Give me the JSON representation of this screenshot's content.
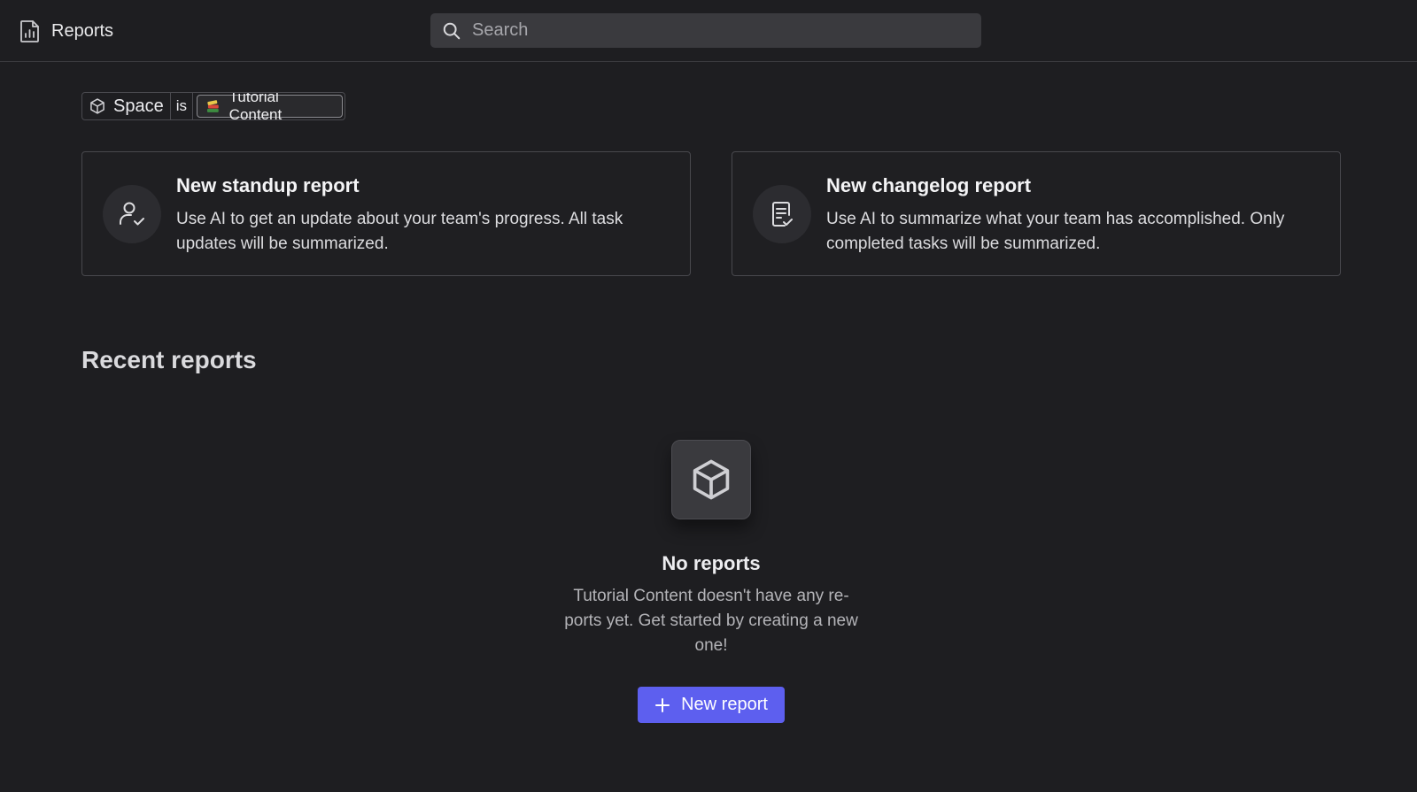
{
  "header": {
    "title": "Reports",
    "title_icon": "report-chart-icon",
    "search_placeholder": "Search"
  },
  "filter": {
    "field_icon": "cube-icon",
    "field": "Space",
    "operator": "is",
    "value_icon": "books-emoji",
    "value": "Tutorial Content"
  },
  "cards": [
    {
      "icon": "user-check-icon",
      "title": "New standup report",
      "description": "Use AI to get an update about your team's progress. All task updates will be summarized."
    },
    {
      "icon": "document-check-icon",
      "title": "New changelog report",
      "description": "Use AI to summarize what your team has accomplished. Only completed tasks will be summarized."
    }
  ],
  "recent": {
    "title": "Recent reports",
    "empty_icon": "cube-icon",
    "empty_title": "No reports",
    "empty_description": "Tutorial Content doesn't have any re-ports yet. Get started by creating a new one!",
    "button_label": "New report",
    "button_icon": "plus-icon"
  },
  "colors": {
    "background": "#1e1e21",
    "accent": "#5d5fef",
    "border": "#48484d"
  }
}
